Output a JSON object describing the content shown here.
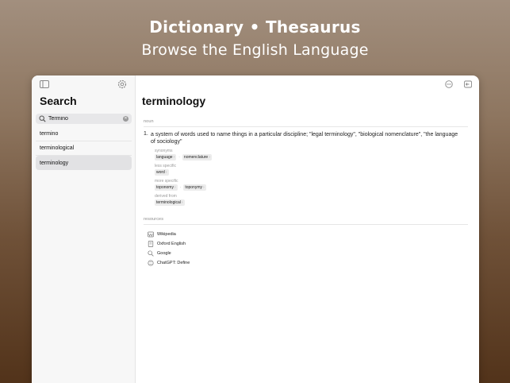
{
  "hero": {
    "title": "Dictionary • Thesaurus",
    "subtitle": "Browse the English Language"
  },
  "sidebar": {
    "title": "Search",
    "search": {
      "value": "Termino",
      "placeholder": "Search"
    },
    "results": [
      "termino",
      "terminological",
      "terminology"
    ],
    "selected_index": 2
  },
  "entry": {
    "word": "terminology",
    "part_of_speech": "noun",
    "senses": [
      {
        "number": "1.",
        "definition": "a system of words used to name things in a particular discipline; \"legal terminology\", \"biological nomenclature\", \"the language of sociology\"",
        "relations": [
          {
            "label": "synonyms",
            "items": [
              "language",
              "nomenclature"
            ]
          },
          {
            "label": "less specific",
            "items": [
              "word"
            ]
          },
          {
            "label": "more specific",
            "items": [
              "toponomy",
              "toponymy"
            ]
          },
          {
            "label": "derived from",
            "items": [
              "terminological"
            ]
          }
        ]
      }
    ]
  },
  "resources": {
    "label": "resources",
    "items": [
      {
        "label": "Wikipedia",
        "icon": "wikipedia-icon"
      },
      {
        "label": "Oxford English",
        "icon": "book-icon"
      },
      {
        "label": "Google",
        "icon": "magnifier-icon"
      },
      {
        "label": "ChatGPT: Define",
        "icon": "chatgpt-icon"
      }
    ]
  },
  "colors": {
    "background_top": "#a28f7e",
    "background_bottom": "#52331a",
    "sidebar_bg": "#f7f7f7",
    "selected_bg": "#e2e2e4"
  }
}
